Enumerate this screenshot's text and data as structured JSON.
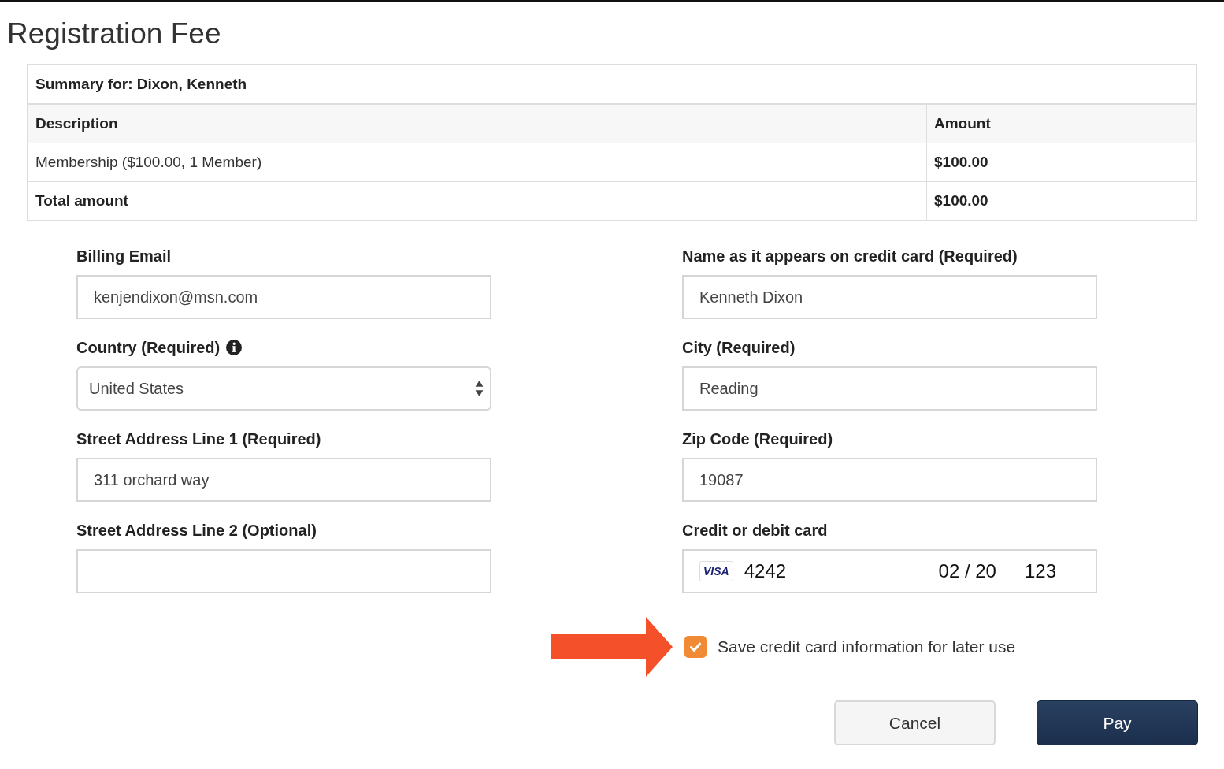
{
  "title": "Registration Fee",
  "summary": {
    "heading": "Summary for: Dixon, Kenneth",
    "columns": [
      "Description",
      "Amount"
    ],
    "rows": [
      {
        "kind": "item",
        "description": "Membership ($100.00, 1 Member)",
        "amount": "$100.00"
      },
      {
        "kind": "total",
        "description": "Total amount",
        "amount": "$100.00"
      }
    ]
  },
  "left_fields": [
    {
      "kind": "text",
      "label": "Billing Email",
      "value": "kenjendixon@msn.com"
    },
    {
      "kind": "select",
      "label": "Country (Required)",
      "value": "United States",
      "info": true
    },
    {
      "kind": "text",
      "label": "Street Address Line 1 (Required)",
      "value": "311 orchard way"
    },
    {
      "kind": "text",
      "label": "Street Address Line 2 (Optional)"
    }
  ],
  "right_fields": [
    {
      "kind": "text",
      "label": "Name as it appears on credit card (Required)",
      "value": "Kenneth Dixon"
    },
    {
      "kind": "text",
      "label": "City (Required)",
      "value": "Reading"
    },
    {
      "kind": "text",
      "label": "Zip Code (Required)",
      "value": "19087"
    },
    {
      "kind": "card",
      "label": "Credit or debit card",
      "brand": "VISA",
      "number": "4242",
      "expiry": "02 / 20",
      "cvc": "123"
    }
  ],
  "save_card": {
    "label": "Save credit card information for later use",
    "checked": true
  },
  "buttons": [
    {
      "kind": "secondary",
      "label": "Cancel"
    },
    {
      "kind": "primary",
      "label": "Pay"
    }
  ]
}
